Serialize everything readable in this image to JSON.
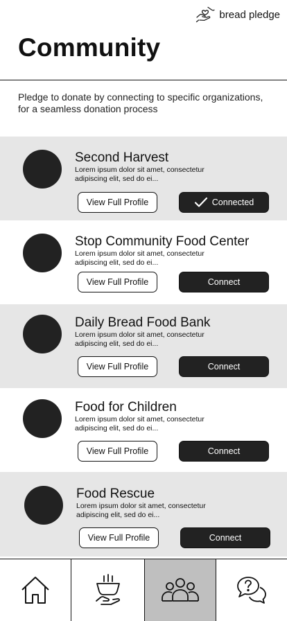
{
  "brand": {
    "name": "bread pledge",
    "icon": "hands-heart-icon"
  },
  "page": {
    "title": "Community",
    "intro": "Pledge to donate by connecting to specific organizations, for a seamless donation process"
  },
  "organizations": [
    {
      "name": "Second Harvest",
      "description": "Lorem ipsum dolor sit amet, consectetur adipiscing elit, sed do ei...",
      "profile_label": "View Full Profile",
      "connect_label": "Connected",
      "connected": true
    },
    {
      "name": "Stop Community Food Center",
      "description": "Lorem ipsum dolor sit amet, consectetur adipiscing elit, sed do ei...",
      "profile_label": "View Full Profile",
      "connect_label": "Connect",
      "connected": false
    },
    {
      "name": "Daily Bread Food Bank",
      "description": "Lorem ipsum dolor sit amet, consectetur adipiscing elit, sed do ei...",
      "profile_label": "View Full Profile",
      "connect_label": "Connect",
      "connected": false
    },
    {
      "name": "Food for Children",
      "description": "Lorem ipsum dolor sit amet, consectetur adipiscing elit, sed do ei...",
      "profile_label": "View Full Profile",
      "connect_label": "Connect",
      "connected": false
    },
    {
      "name": "Food Rescue",
      "description": "Lorem ipsum dolor sit amet, consectetur adipiscing elit, sed do ei...",
      "profile_label": "View Full Profile",
      "connect_label": "Connect",
      "connected": false
    }
  ],
  "nav": {
    "items": [
      {
        "icon": "home-icon",
        "active": false
      },
      {
        "icon": "donate-food-icon",
        "active": false
      },
      {
        "icon": "community-icon",
        "active": true
      },
      {
        "icon": "help-chat-icon",
        "active": false
      }
    ]
  },
  "colors": {
    "shade": "#e6e6e6",
    "dark": "#222222",
    "active_nav": "#bfbfbf"
  }
}
